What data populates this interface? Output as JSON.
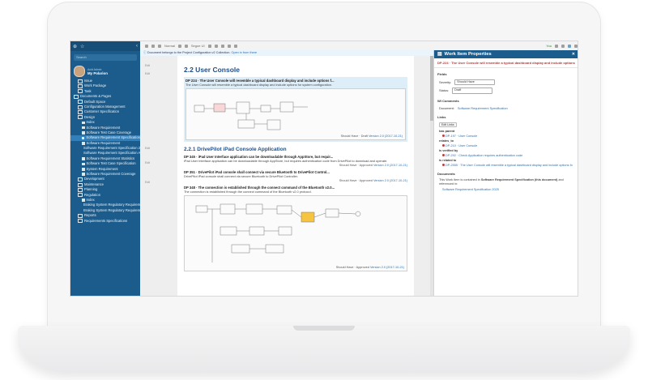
{
  "sidebar": {
    "search_placeholder": "Search",
    "user_role": "Acid Admin",
    "project": "My Polarion",
    "items": [
      {
        "label": "Issue",
        "indent": 1
      },
      {
        "label": "Work Package",
        "indent": 1
      },
      {
        "label": "Task",
        "indent": 1
      },
      {
        "label": "Documents & Pages",
        "indent": 0
      },
      {
        "label": "Default Space",
        "indent": 1
      },
      {
        "label": "Configuration Management",
        "indent": 1
      },
      {
        "label": "Customer Specification",
        "indent": 1
      },
      {
        "label": "Design",
        "indent": 1
      },
      {
        "label": "Index",
        "indent": 2
      },
      {
        "label": "Software Requirement",
        "indent": 2
      },
      {
        "label": "Software Test Case Coverage",
        "indent": 2
      },
      {
        "label": "Software Requirement Specification",
        "indent": 2,
        "selected": true
      },
      {
        "label": "Software Requirement",
        "indent": 2
      },
      {
        "label": "Software Requirement Specification 2025",
        "indent": 2
      },
      {
        "label": "Software Requirement Specification Approval Status",
        "indent": 2
      },
      {
        "label": "Software Requirement Statistics",
        "indent": 2
      },
      {
        "label": "Software Test Case Specification",
        "indent": 2
      },
      {
        "label": "System Requirement",
        "indent": 2
      },
      {
        "label": "Software Requirement Coverage",
        "indent": 2
      },
      {
        "label": "Development",
        "indent": 1
      },
      {
        "label": "Maintenance",
        "indent": 1
      },
      {
        "label": "Planning",
        "indent": 1
      },
      {
        "label": "Regulation",
        "indent": 1
      },
      {
        "label": "Index",
        "indent": 2
      },
      {
        "label": "Braking System Regulatory Requirements",
        "indent": 2
      },
      {
        "label": "Braking System Regulatory Requirements New",
        "indent": 2
      },
      {
        "label": "Reports",
        "indent": 1
      },
      {
        "label": "Requirements Specifications",
        "indent": 1
      }
    ]
  },
  "toolbar": {
    "style_label": "Normal",
    "font_label": "Segoe UI",
    "user_label": "You"
  },
  "infobar": {
    "text": "Document belongs to the Project Configuration v2 Collection.",
    "link": "Open in from there"
  },
  "document": {
    "h1": "2.2 User Console",
    "items": [
      {
        "id": "DP-224",
        "title": "DP 224 · The User Console will resemble a typical dashboard display and include options f...",
        "text": "The User Console will resemble a typical dashboard display and include options for system configuration.",
        "meta": "Should Have · Draft",
        "version": "Version 2.0 (2017-10-21)"
      }
    ],
    "h2": "2.2.1 DrivePilot iPad Console Application",
    "items2": [
      {
        "title": "DP 345 · iPad User Interface application can be downloadable through AppStore, but requir...",
        "text": "iPad User Interface application can be downloadable through AppStore, but requires authentication code from DrivePilot to download and operate.",
        "meta": "Should Have · Approved",
        "version": "Version 2.0 (2017-10-21)"
      },
      {
        "title": "DP 351 · DrivePilot iPad console shall connect via secure Bluetooth to DrivePilot Control...",
        "text": "DrivePilot iPad console shall connect via secure Bluetooth to DrivePilot Controller.",
        "meta": "Should Have · Approved",
        "version": "Version 2.0 (2017-10-21)"
      },
      {
        "title": "DP 348 · The connection is established through the connect command of the Bluetooth v2.0...",
        "text": "The connection is established through the connect command of the Bluetooth v2.0 protocol.",
        "meta": "Should Have · Approved",
        "version": "Version 2.0 (2017-10-21)"
      }
    ],
    "gutter": [
      "Edit",
      "Edit",
      "Edit",
      "Edit",
      "Edit"
    ]
  },
  "panel": {
    "title": "Work Item Properties",
    "item_title": "DP-224 · The User Console will resemble a typical dashboard display and include options",
    "fields_label": "Fields",
    "severity_label": "Severity:",
    "severity_value": "Should Have",
    "status_label": "Status:",
    "status_value": "Draft",
    "comments_label": "WI Comments",
    "document_label": "Document:",
    "document_value": "Software Requirement Specification",
    "links_label": "Links",
    "edit_links": "Edit Links",
    "has_parent": "has parent",
    "parent_link": "DP-197 · User Console",
    "relates_to": "relates_to",
    "relates_link": "DP-210 · User Console",
    "verified_by": "is verified by",
    "verified_link": "DP-292 · Check Application requires authentication code",
    "related_to": "is related to",
    "related_link": "DP-2555 · The User Console will resemble a typical dashboard display and include options fo",
    "documents_label": "Documents",
    "documents_text": "This Work Item is contained in",
    "documents_bold": "Software Requirement Specification (this document)",
    "documents_text2": "and referenced in:",
    "referenced_link": "Software Requirement Specification 2025"
  }
}
